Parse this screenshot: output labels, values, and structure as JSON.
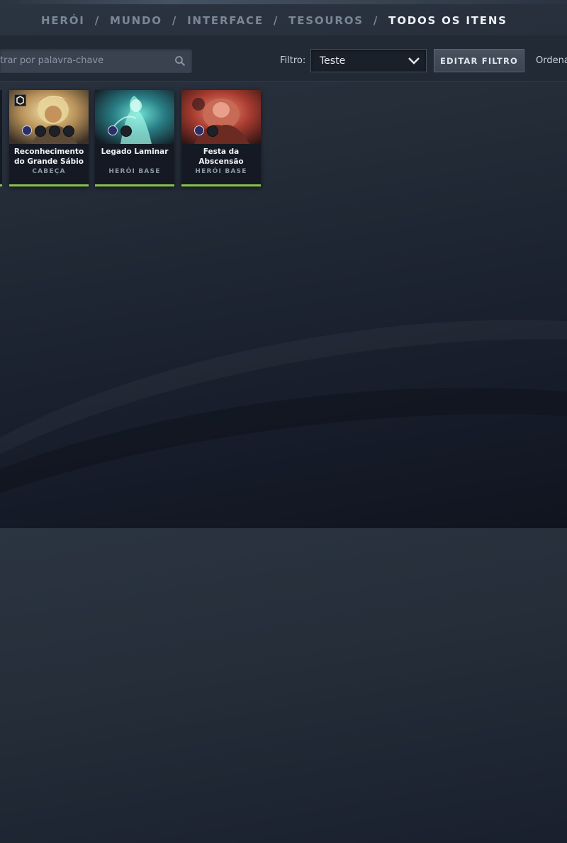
{
  "breadcrumb": {
    "items": [
      "HERÓI",
      "MUNDO",
      "INTERFACE",
      "TESOUROS"
    ],
    "current": "TODOS OS ITENS",
    "separator": "/"
  },
  "search": {
    "text": "trar por palavra-chave",
    "icon": "search-icon"
  },
  "filter": {
    "label": "Filtro:",
    "selected": "Teste",
    "edit_button": "EDITAR FILTRO"
  },
  "sort": {
    "label": "Ordena"
  },
  "items": [
    {
      "name": "Reconhecimento do Grande Sábio",
      "type": "CABEÇA",
      "gems_filled": 1,
      "gems_empty": 3,
      "has_badge": true
    },
    {
      "name": "Legado Laminar",
      "type": "HERÓI BASE",
      "gems_filled": 1,
      "gems_empty": 1,
      "has_badge": false
    },
    {
      "name": "Festa da Abscensão",
      "type": "HERÓI BASE",
      "gems_filled": 1,
      "gems_empty": 1,
      "has_badge": false
    }
  ],
  "colors": {
    "rarity_bar": "#8bc34a",
    "background_top": "#2b3441",
    "background_bottom": "#10141f"
  }
}
